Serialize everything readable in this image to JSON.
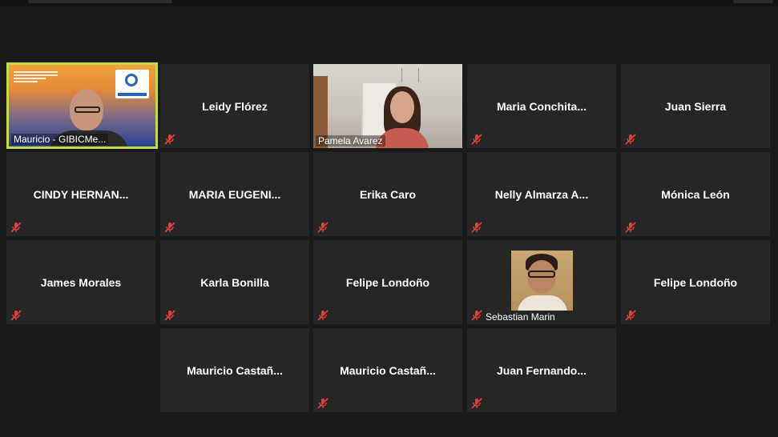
{
  "participants": [
    {
      "name": "Mauricio - GIBICMe...",
      "video": true,
      "active": true
    },
    {
      "name": "Leidy Flórez",
      "muted": true
    },
    {
      "name": "Pamela Avarez",
      "video": true
    },
    {
      "name": "Maria  Conchita...",
      "muted": true
    },
    {
      "name": "Juan Sierra",
      "muted": true
    },
    {
      "name": "CINDY  HERNAN...",
      "muted": true
    },
    {
      "name": "MARIA  EUGENI...",
      "muted": true
    },
    {
      "name": "Erika Caro",
      "muted": true
    },
    {
      "name": "Nelly  Almarza  A...",
      "muted": true
    },
    {
      "name": "Mónica León",
      "muted": true
    },
    {
      "name": "James Morales",
      "muted": true
    },
    {
      "name": "Karla Bonilla",
      "muted": true
    },
    {
      "name": "Felipe Londoño",
      "muted": true
    },
    {
      "name": "Sebastian Marin",
      "video": true,
      "muted": true
    },
    {
      "name": "Felipe Londoño",
      "muted": true
    },
    {
      "name": "Mauricio  Castañ...",
      "muted": true
    },
    {
      "name": "Mauricio  Castañ...",
      "muted": true
    },
    {
      "name": "Juan  Fernando...",
      "muted": true
    }
  ],
  "colors": {
    "background": "#1a1a1a",
    "tile": "#262626",
    "active_speaker_border": "#c8d94a",
    "muted_icon": "#e0413b"
  },
  "icons": {
    "muted": "microphone-muted-icon"
  }
}
